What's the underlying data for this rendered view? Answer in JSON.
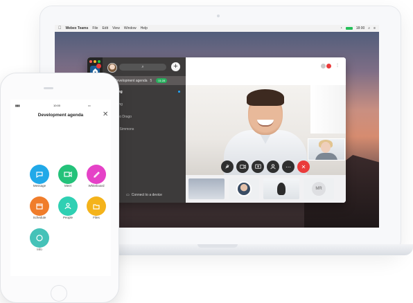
{
  "mac": {
    "menu": [
      "Webex Teams",
      "File",
      "Edit",
      "View",
      "Window",
      "Help"
    ],
    "time": "18:00"
  },
  "webex": {
    "sidebar": {
      "search_icon": "search-icon",
      "add_icon": "plus-icon",
      "items": [
        {
          "label": "Development agenda",
          "meta": "5",
          "time_badge": "01:28"
        },
        {
          "label": "Sourcing"
        },
        {
          "label": "Marketing"
        },
        {
          "label": "Giacomo Drago"
        },
        {
          "label": "Brenda Simmons"
        }
      ],
      "connect_label": "Connect to a device"
    },
    "call": {
      "controls": [
        "mic",
        "video",
        "share",
        "people",
        "more",
        "end"
      ],
      "thumb_initials": "MR"
    }
  },
  "phone": {
    "time": "10:00",
    "title": "Development agenda",
    "tiles": [
      {
        "label": "Message",
        "color": "#21a9e8"
      },
      {
        "label": "Meet",
        "color": "#24c27a"
      },
      {
        "label": "Whiteboard",
        "color": "#e542c7"
      },
      {
        "label": "Schedule",
        "color": "#f07d2b"
      },
      {
        "label": "People",
        "color": "#2fd0b3"
      },
      {
        "label": "Files",
        "color": "#f4b31b"
      },
      {
        "label": "Info",
        "color": "#45c2b8"
      }
    ]
  }
}
